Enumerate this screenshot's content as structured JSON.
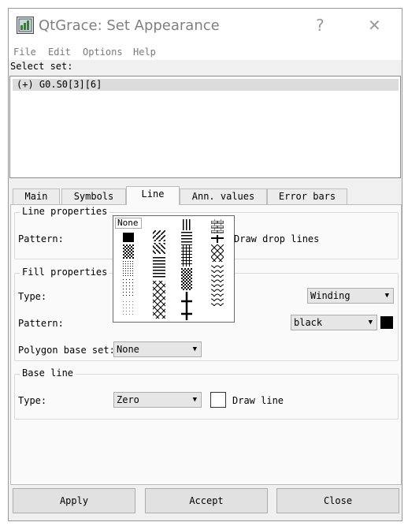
{
  "window": {
    "title": "QtGrace: Set Appearance",
    "help_glyph": "?",
    "close_glyph": "✕"
  },
  "menu": [
    "File",
    "Edit",
    "Options",
    "Help"
  ],
  "select_set": {
    "label": "Select set:",
    "items": [
      "(+) G0.S0[3][6]"
    ]
  },
  "tabs": [
    "Main",
    "Symbols",
    "Line",
    "Ann. values",
    "Error bars"
  ],
  "active_tab": "Line",
  "line_properties": {
    "title": "Line properties",
    "pattern_label": "Pattern:",
    "drop_lines_label": "Draw drop lines"
  },
  "fill_properties": {
    "title": "Fill properties",
    "type_label": "Type:",
    "rule_value": "Winding",
    "pattern_label": "Pattern:",
    "color_value": "black",
    "color_hex": "#000000",
    "base_set_label": "Polygon base set:",
    "base_set_value": "None"
  },
  "base_line": {
    "title": "Base line",
    "type_label": "Type:",
    "type_value": "Zero",
    "draw_line_label": "Draw line"
  },
  "pattern_popup": {
    "none_label": "None"
  },
  "buttons": {
    "apply": "Apply",
    "accept": "Accept",
    "close": "Close"
  }
}
